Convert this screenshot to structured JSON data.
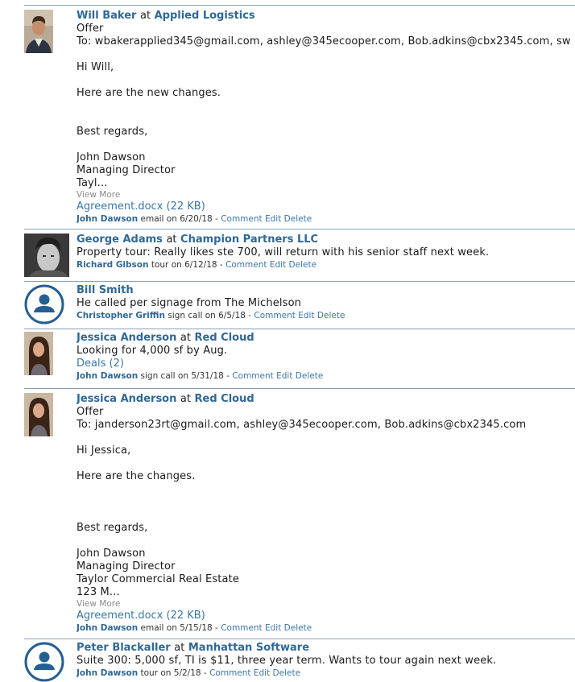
{
  "entries": [
    {
      "name": "Will Baker",
      "at": "at",
      "company": "Applied Logistics",
      "subject": "Offer",
      "to": "To: wbakerapplied345@gmail.com, ashley@345ecooper.com, Bob.adkins@cbx2345.com, sw",
      "greeting": "Hi Will,",
      "body": "Here are the new changes.",
      "closing": "Best regards,",
      "sig1": "John Dawson",
      "sig2": "Managing Director",
      "sig3": "Tayl...",
      "view_more": "View More",
      "attachment": "Agreement.docx (22 KB)",
      "author": "John Dawson",
      "meta_text": "email on 6/20/18 -",
      "comment": "Comment",
      "edit": "Edit",
      "delete": "Delete",
      "avatar": "photo-man-smiling"
    },
    {
      "name": "George Adams",
      "at": "at",
      "company": "Champion Partners LLC",
      "body": "Property tour: Really likes ste 700, will return with his senior staff next week.",
      "author": "Richard Gibson",
      "meta_text": "tour on 6/12/18 -",
      "comment": "Comment",
      "edit": "Edit",
      "delete": "Delete",
      "avatar": "photo-man-bw"
    },
    {
      "name": "Bill Smith",
      "body": "He called per signage from The Michelson",
      "author": "Christopher Griffin",
      "meta_text": "sign call on 6/5/18 -",
      "comment": "Comment",
      "edit": "Edit",
      "delete": "Delete",
      "avatar": "default-user-icon"
    },
    {
      "name": "Jessica Anderson",
      "at": "at",
      "company": "Red Cloud",
      "body": "Looking for 4,000 sf by Aug.",
      "deals_label": "Deals",
      "deals_count": "(2)",
      "author": "John Dawson",
      "meta_text": "sign call on 5/31/18 -",
      "comment": "Comment",
      "edit": "Edit",
      "delete": "Delete",
      "avatar": "photo-woman"
    },
    {
      "name": "Jessica Anderson",
      "at": "at",
      "company": "Red Cloud",
      "subject": "Offer",
      "to": "To: janderson23rt@gmail.com, ashley@345ecooper.com, Bob.adkins@cbx2345.com",
      "greeting": "Hi Jessica,",
      "body": "Here are the changes.",
      "closing": "Best regards,",
      "sig1": "John Dawson",
      "sig2": "Managing Director",
      "sig3": "Taylor Commercial Real Estate",
      "sig4": "123 M...",
      "view_more": "View More",
      "attachment": "Agreement.docx (22 KB)",
      "author": "John Dawson",
      "meta_text": "email on 5/15/18 -",
      "comment": "Comment",
      "edit": "Edit",
      "delete": "Delete",
      "avatar": "photo-woman"
    },
    {
      "name": "Peter Blackaller",
      "at": "at",
      "company": "Manhattan Software",
      "body": "Suite 300: 5,000 sf, TI is $11, three year term. Wants to tour again next week.",
      "author": "John Dawson",
      "meta_text": "tour on 5/2/18 -",
      "comment": "Comment",
      "edit": "Edit",
      "delete": "Delete",
      "avatar": "default-user-icon"
    }
  ],
  "colors": {
    "link": "#2f6796",
    "separator": "#8aa2b8",
    "muted": "#888888"
  }
}
